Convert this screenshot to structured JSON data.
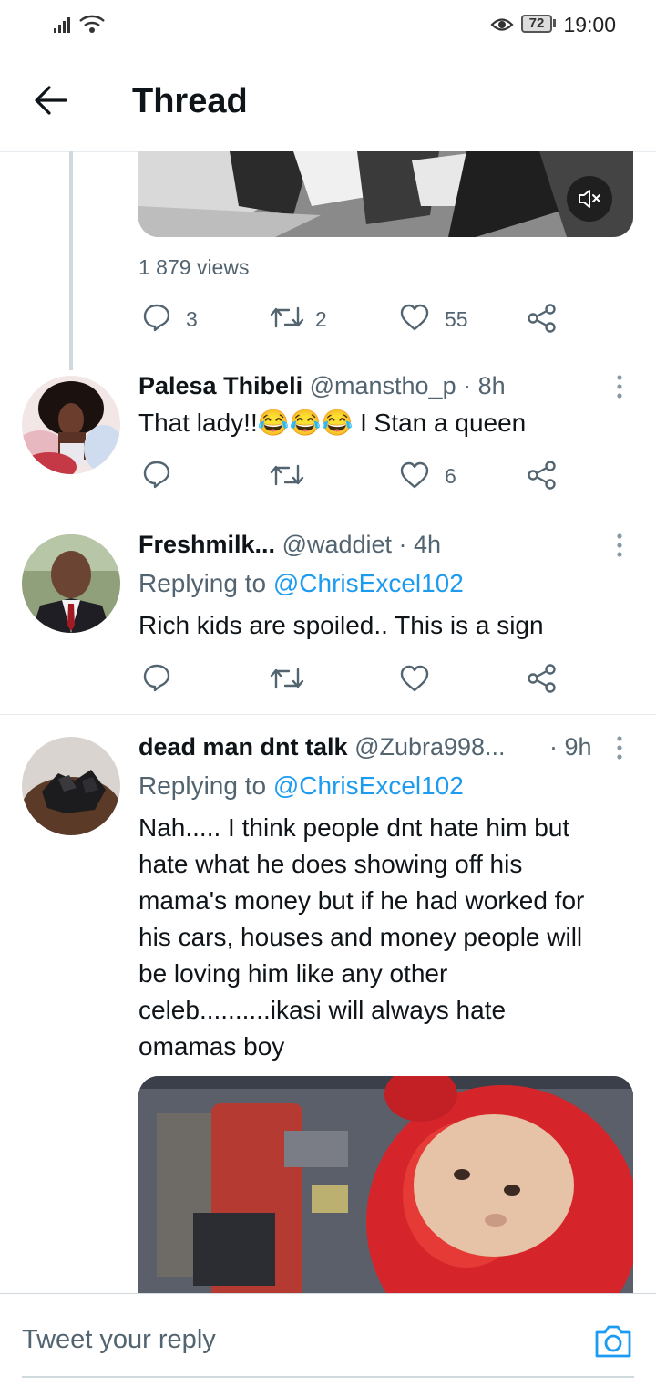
{
  "status_bar": {
    "time": "19:00",
    "battery": "72"
  },
  "header": {
    "title": "Thread"
  },
  "media_tweet": {
    "views": "1 879 views",
    "replies": "3",
    "retweets": "2",
    "likes": "55"
  },
  "tweets": [
    {
      "name": "Palesa Thibeli",
      "handle": "@manstho_p · 8h",
      "text": "That lady!!😂😂😂 I Stan a queen",
      "replies": "",
      "retweets": "",
      "likes": "6"
    },
    {
      "name": "Freshmilk...",
      "handle": "@waddiet · 4h",
      "reply_prefix": "Replying to",
      "reply_to": "@ChrisExcel102",
      "text": "Rich kids are spoiled.. This is a sign"
    },
    {
      "name": "dead man dnt talk",
      "handle": "@Zubra998...",
      "time": "· 9h",
      "reply_prefix": "Replying to",
      "reply_to": "@ChrisExcel102",
      "text_lines": [
        "Nah..... I think people dnt hate him but",
        "hate what he does showing off his",
        "mama's money but if he had worked for",
        "his cars, houses and money people will",
        "be loving him like any other",
        "celeb..........ikasi will always hate",
        "omamas boy"
      ]
    }
  ],
  "composer": {
    "placeholder": "Tweet your reply"
  },
  "colors": {
    "accent": "#1d9bf0",
    "muted": "#536471",
    "divider": "#e6ecf0"
  },
  "icons": [
    "signal-icon",
    "wifi-icon",
    "eye-comfort-icon",
    "battery-icon",
    "back-arrow-icon",
    "mute-icon",
    "reply-icon",
    "retweet-icon",
    "like-icon",
    "share-icon",
    "more-icon",
    "camera-icon"
  ]
}
